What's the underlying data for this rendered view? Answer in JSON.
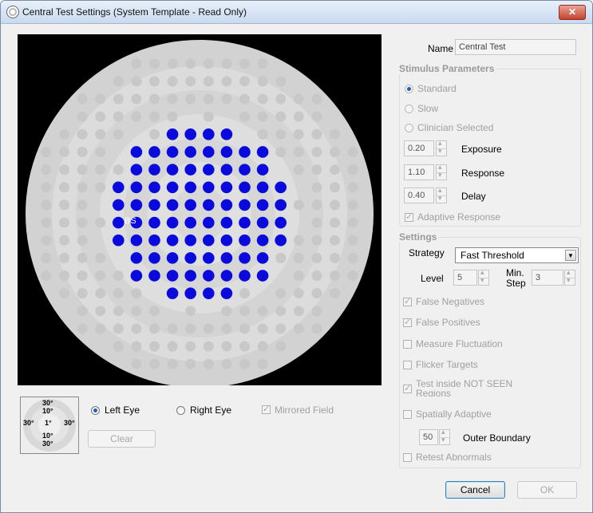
{
  "window": {
    "title": "Central Test Settings (System Template - Read Only)",
    "close_label": "✕"
  },
  "field": {
    "blind_spot_label": "BS"
  },
  "mini_map": {
    "top": "30°",
    "inner_top": "10°",
    "left": "30°",
    "center": "1°",
    "right": "30°",
    "inner_bottom": "10°",
    "bottom": "30°"
  },
  "eye": {
    "left_label": "Left Eye",
    "right_label": "Right Eye",
    "selected": "Left Eye",
    "mirrored_label": "Mirrored Field",
    "mirrored_checked": true
  },
  "clear_label": "Clear",
  "name": {
    "label": "Name",
    "value": "Central Test"
  },
  "stimulus": {
    "title": "Stimulus Parameters",
    "options": [
      "Standard",
      "Slow",
      "Clinician Selected"
    ],
    "selected": "Standard",
    "exposure": {
      "value": "0.20",
      "label": "Exposure"
    },
    "response": {
      "value": "1.10",
      "label": "Response"
    },
    "delay": {
      "value": "0.40",
      "label": "Delay"
    },
    "adaptive_label": "Adaptive Response",
    "adaptive_checked": true
  },
  "settings": {
    "title": "Settings",
    "strategy_label": "Strategy",
    "strategy_value": "Fast Threshold",
    "level_label": "Level",
    "level_value": "5",
    "min_step_label": "Min. Step",
    "min_step_value": "3",
    "checks": [
      {
        "label": "False Negatives",
        "checked": true
      },
      {
        "label": "False Positives",
        "checked": true
      },
      {
        "label": "Measure Fluctuation",
        "checked": false
      },
      {
        "label": "Flicker Targets",
        "checked": false
      },
      {
        "label": "Test inside NOT SEEN Regions",
        "checked": true
      },
      {
        "label": "Spatially Adaptive",
        "checked": false
      }
    ],
    "outer_boundary_value": "50",
    "outer_boundary_label": "Outer Boundary",
    "retest_label": "Retest Abnormals",
    "retest_checked": false
  },
  "footer": {
    "cancel_label": "Cancel",
    "ok_label": "OK"
  },
  "colors": {
    "test_point": "#0a0adc",
    "inactive_point": "#c8c8c8",
    "background": "#000000"
  }
}
